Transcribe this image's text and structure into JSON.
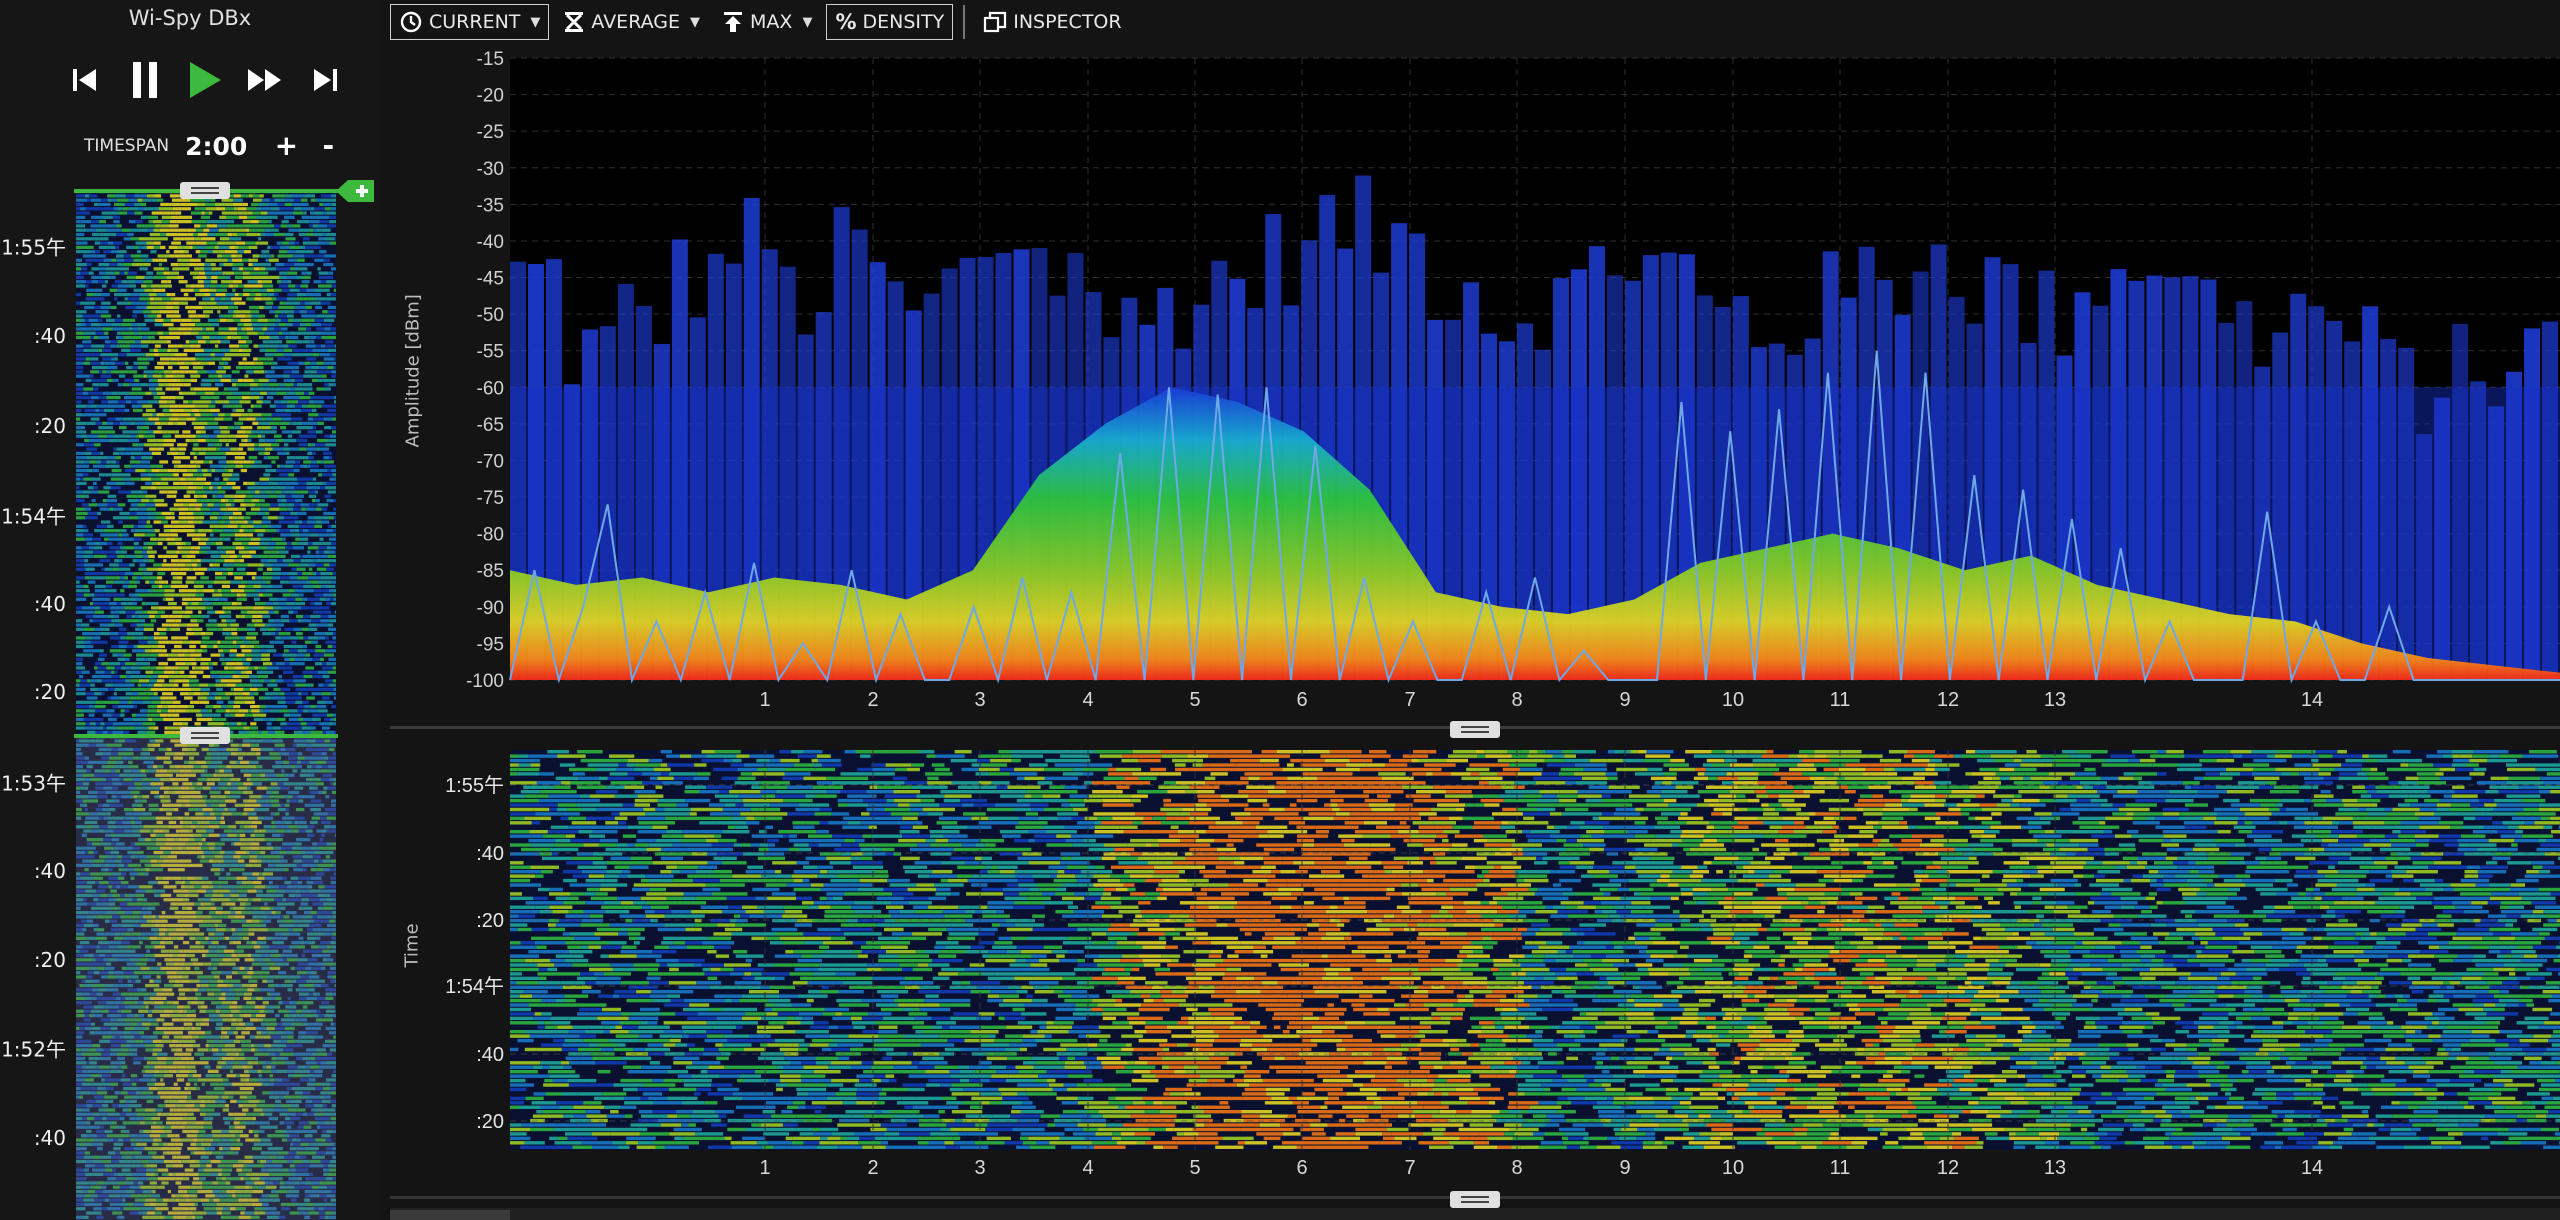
{
  "device": {
    "name": "Wi-Spy DBx"
  },
  "transport": {
    "buttons": [
      "skip-back",
      "pause",
      "play",
      "fast-forward",
      "skip-forward"
    ]
  },
  "timespan": {
    "label": "TIMESPAN",
    "value": "2:00",
    "plus": "+",
    "minus": "-"
  },
  "mini_waterfall": {
    "time_labels": [
      ":20",
      ":40",
      "1:54午",
      ":20",
      ":40",
      "1:55午"
    ],
    "dim_time_labels": [
      ":40",
      "1:52午",
      ":20",
      ":40",
      "1:53午"
    ]
  },
  "toolbar": {
    "current": "CURRENT",
    "average": "AVERAGE",
    "max": "MAX",
    "density": "DENSITY",
    "density_symbol": "%",
    "inspector": "INSPECTOR"
  },
  "colors": {
    "background": "#141414",
    "plot_bg": "#000000",
    "active_green": "#3dba3d",
    "max_trace": "#1f3fe0",
    "current_trace": "#6fa8e6",
    "waterfall_bg": "#0a1030"
  },
  "chart_data": [
    {
      "type": "area",
      "ylabel": "Amplitude [dBm]",
      "ylim": [
        -100,
        -15
      ],
      "yticks": [
        -15,
        -20,
        -25,
        -30,
        -35,
        -40,
        -45,
        -50,
        -55,
        -60,
        -65,
        -70,
        -75,
        -80,
        -85,
        -90,
        -95,
        -100
      ],
      "channels": [
        "1",
        "2",
        "3",
        "4",
        "5",
        "6",
        "7",
        "8",
        "9",
        "10",
        "11",
        "12",
        "13",
        "14"
      ],
      "grid": true,
      "series": [
        {
          "name": "MAX",
          "values": [
            -45,
            -55,
            -50,
            -45,
            -40,
            -48,
            -42,
            -50,
            -45,
            -40,
            -44,
            -52,
            -48,
            -45,
            -42,
            -38,
            -40,
            -45,
            -50,
            -48,
            -42,
            -44,
            -50,
            -52,
            -48,
            -45,
            -42,
            -46,
            -50,
            -45,
            -42,
            -48,
            -52,
            -50,
            -55,
            -60,
            -58,
            -55
          ]
        },
        {
          "name": "DENSITY",
          "values": [
            -85,
            -87,
            -86,
            -88,
            -86,
            -87,
            -89,
            -85,
            -72,
            -65,
            -60,
            -62,
            -66,
            -74,
            -88,
            -90,
            -91,
            -89,
            -84,
            -82,
            -80,
            -82,
            -85,
            -83,
            -87,
            -89,
            -91,
            -92,
            -95,
            -97,
            -98,
            -99
          ]
        },
        {
          "name": "CURRENT",
          "values": [
            -100,
            -85,
            -100,
            -90,
            -76,
            -100,
            -92,
            -100,
            -88,
            -100,
            -84,
            -100,
            -95,
            -100,
            -85,
            -100,
            -91,
            -100,
            -100,
            -90,
            -100,
            -86,
            -100,
            -88,
            -100,
            -69,
            -100,
            -60,
            -100,
            -61,
            -100,
            -60,
            -100,
            -68,
            -100,
            -86,
            -100,
            -92,
            -100,
            -100,
            -88,
            -100,
            -86,
            -100,
            -96,
            -100,
            -100,
            -100,
            -62,
            -100,
            -66,
            -100,
            -63,
            -100,
            -58,
            -100,
            -55,
            -100,
            -58,
            -100,
            -72,
            -100,
            -74,
            -100,
            -78,
            -100,
            -82,
            -100,
            -92,
            -100,
            -100,
            -100,
            -77,
            -100,
            -92,
            -100,
            -100,
            -90,
            -100,
            -100,
            -100,
            -100,
            -100,
            -100,
            -100
          ]
        }
      ]
    },
    {
      "type": "heatmap",
      "ylabel": "Time",
      "yticks": [
        "1:55午",
        ":40",
        ":20",
        "1:54午",
        ":40",
        ":20"
      ],
      "channels": [
        "1",
        "2",
        "3",
        "4",
        "5",
        "6",
        "7",
        "8",
        "9",
        "10",
        "11",
        "12",
        "13",
        "14"
      ]
    }
  ]
}
